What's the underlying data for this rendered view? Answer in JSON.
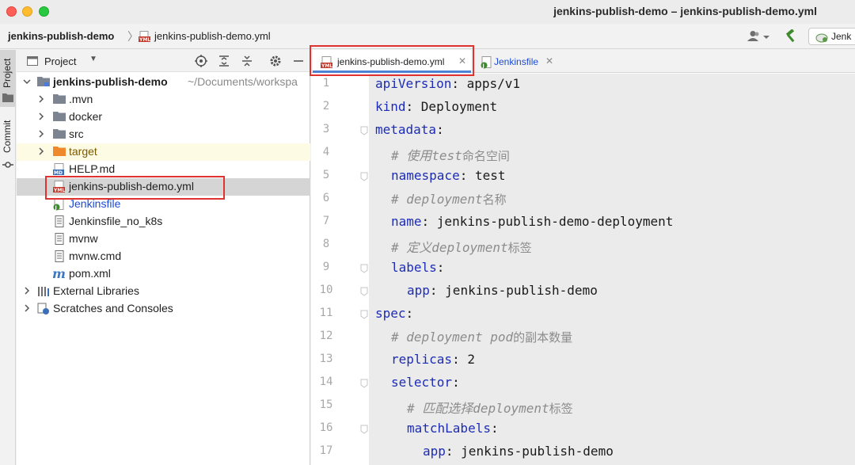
{
  "window": {
    "title": "jenkins-publish-demo – jenkins-publish-demo.yml"
  },
  "navbar": {
    "project": "jenkins-publish-demo",
    "file": "jenkins-publish-demo.yml",
    "run_config": "Jenk"
  },
  "toolstrip": {
    "project_label": "Project",
    "commit_label": "Commit"
  },
  "project_panel": {
    "title": "Project",
    "root": {
      "name": "jenkins-publish-demo",
      "path": "~/Documents/workspa"
    },
    "items": [
      {
        "label": ".mvn",
        "type": "folder"
      },
      {
        "label": "docker",
        "type": "folder"
      },
      {
        "label": "src",
        "type": "folder"
      },
      {
        "label": "target",
        "type": "folder-excluded"
      },
      {
        "label": "HELP.md",
        "type": "md"
      },
      {
        "label": "jenkins-publish-demo.yml",
        "type": "yml"
      },
      {
        "label": "Jenkinsfile",
        "type": "jenkins"
      },
      {
        "label": "Jenkinsfile_no_k8s",
        "type": "text"
      },
      {
        "label": "mvnw",
        "type": "text"
      },
      {
        "label": "mvnw.cmd",
        "type": "text"
      },
      {
        "label": "pom.xml",
        "type": "maven"
      }
    ],
    "external_libraries": "External Libraries",
    "scratches": "Scratches and Consoles"
  },
  "editor": {
    "tabs": [
      {
        "label": "jenkins-publish-demo.yml",
        "active": true
      },
      {
        "label": "Jenkinsfile",
        "active": false
      }
    ],
    "line_numbers": [
      "1",
      "2",
      "3",
      "4",
      "5",
      "6",
      "7",
      "8",
      "9",
      "10",
      "11",
      "12",
      "13",
      "14",
      "15",
      "16",
      "17"
    ],
    "code": [
      {
        "key": "apiVersion",
        "sep": ": ",
        "value": "apps/v1"
      },
      {
        "key": "kind",
        "sep": ": ",
        "value": "Deployment"
      },
      {
        "key": "metadata",
        "sep": ":",
        "value": ""
      },
      {
        "comment_prefix": "# 使用",
        "comment_en": "test",
        "comment_suffix": "命名空间"
      },
      {
        "key": "namespace",
        "sep": ": ",
        "value": "test"
      },
      {
        "comment_prefix": "# ",
        "comment_en": "deployment",
        "comment_suffix": "名称"
      },
      {
        "key": "name",
        "sep": ": ",
        "value": "jenkins-publish-demo-deployment"
      },
      {
        "comment_prefix": "# 定义",
        "comment_en": "deployment",
        "comment_suffix": "标签"
      },
      {
        "key": "labels",
        "sep": ":",
        "value": ""
      },
      {
        "key": "app",
        "sep": ": ",
        "value": "jenkins-publish-demo"
      },
      {
        "key": "spec",
        "sep": ":",
        "value": ""
      },
      {
        "comment_prefix": "# ",
        "comment_en": "deployment pod",
        "comment_suffix": "的副本数量"
      },
      {
        "key": "replicas",
        "sep": ": ",
        "value": "2"
      },
      {
        "key": "selector",
        "sep": ":",
        "value": ""
      },
      {
        "comment_prefix": "# 匹配选择",
        "comment_en": "deployment",
        "comment_suffix": "标签"
      },
      {
        "key": "matchLabels",
        "sep": ":",
        "value": ""
      },
      {
        "key": "app",
        "sep": ": ",
        "value": "jenkins-publish-demo"
      }
    ]
  },
  "colors": {
    "keyword": "#1d2cb5",
    "comment": "#8c8c8c",
    "highlight_box": "#e0322f",
    "active_tab_underline": "#4b82d6"
  }
}
